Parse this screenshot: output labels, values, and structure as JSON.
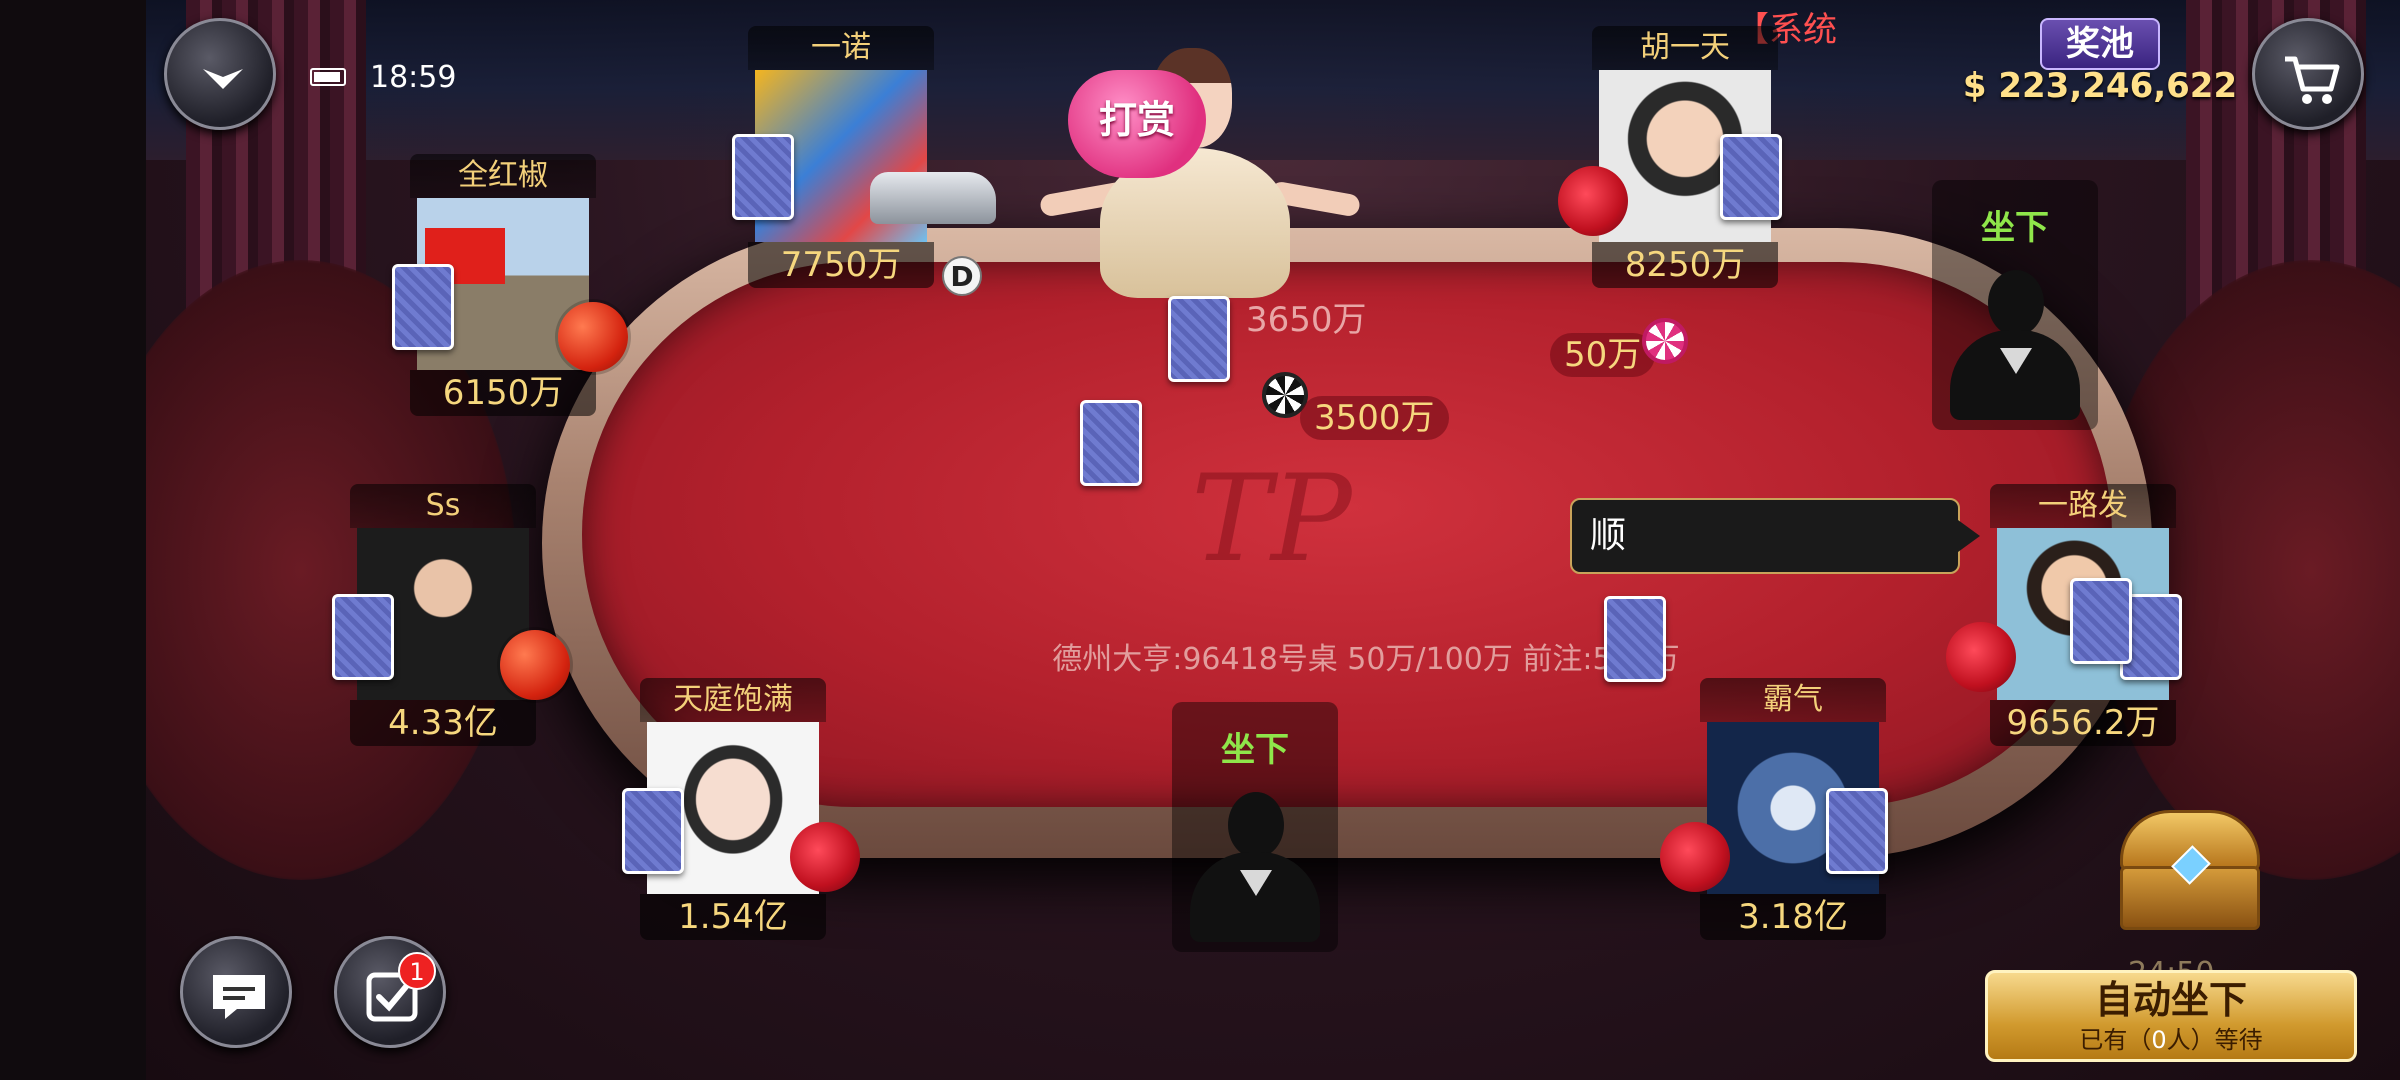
{
  "status": {
    "time": "18:59"
  },
  "system_message": "【系统",
  "jackpot": {
    "title": "奖池",
    "amount": "$ 223,246,622"
  },
  "tip_button": "打赏",
  "table_info": "德州大亨:96418号桌  50万/100万  前注:500万",
  "table_logo": "TP",
  "pot": {
    "main": "3500万",
    "side": "3650万"
  },
  "bets": {
    "hu_yitian": "50万"
  },
  "dealer_button": "D",
  "players": [
    {
      "name": "一诺",
      "chips": "7750万"
    },
    {
      "name": "胡一天",
      "chips": "8250万"
    },
    {
      "name": "全红椒",
      "chips": "6150万"
    },
    {
      "name": "Ss",
      "chips": "4.33亿"
    },
    {
      "name": "天庭饱满",
      "chips": "1.54亿"
    },
    {
      "name": "霸气",
      "chips": "3.18亿"
    },
    {
      "name": "一路发",
      "chips": "9656.2万"
    }
  ],
  "empty_seats": {
    "top_right": "坐下",
    "bottom_center": "坐下"
  },
  "speech_bubble": "顺",
  "auto_sit": {
    "title": "自动坐下",
    "waiting_prefix": "已有（",
    "waiting_count": "0",
    "waiting_suffix": "人）等待"
  },
  "notifications": {
    "task_badge": "1"
  },
  "timer": "24:50",
  "icons": [
    "dropdown-icon",
    "battery-icon",
    "cart-icon",
    "chat-icon",
    "task-icon",
    "treasure-chest-icon",
    "chip-icon",
    "tomato-gift-icon",
    "rose-gift-icon",
    "flag-icon"
  ]
}
